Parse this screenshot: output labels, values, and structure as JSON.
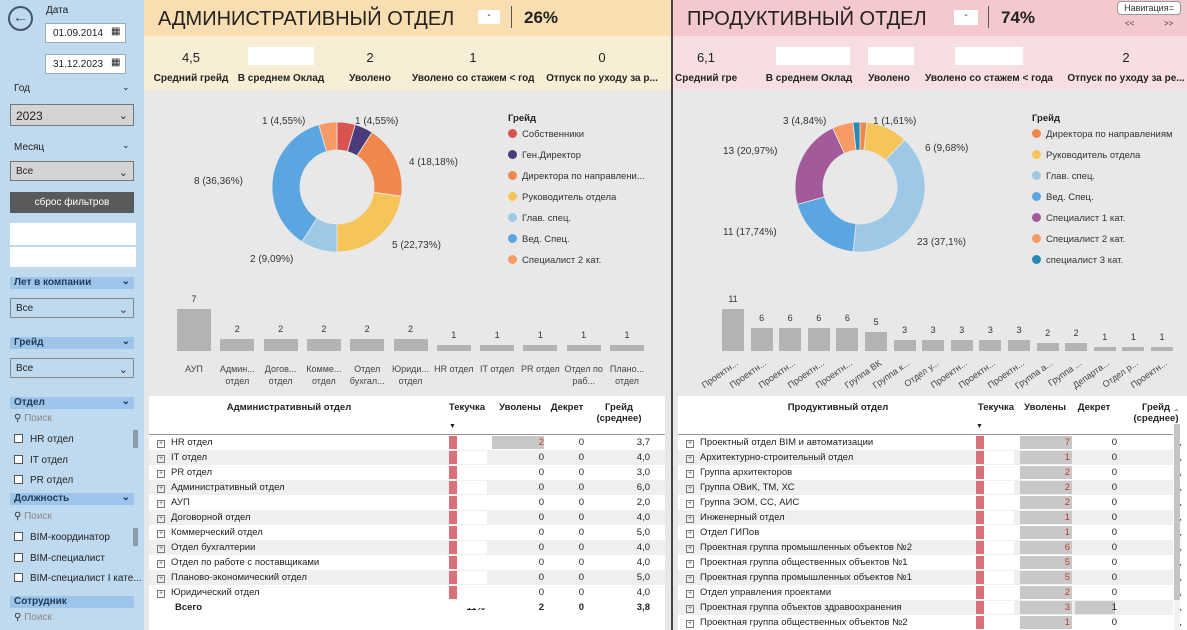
{
  "sidebar": {
    "date_label": "Дата",
    "date_from": "01.09.2014",
    "date_to": "31.12.2023",
    "year_label": "Год",
    "year_value": "2023",
    "month_label": "Месяц",
    "month_value": "Все",
    "reset_label": "сброс фильтров",
    "years_label": "Лет в компании",
    "years_value": "Все",
    "grade_label": "Грейд",
    "grade_value": "Все",
    "dept_label": "Отдел",
    "search_placeholder": "Поиск",
    "dept_items": [
      "HR отдел",
      "IT отдел",
      "PR отдел"
    ],
    "position_label": "Должность",
    "position_items": [
      "BIM-координатор",
      "BIM-специалист",
      "BIM-специалист I кате..."
    ],
    "employee_label": "Сотрудник"
  },
  "nav_label": "Навигация",
  "nav_prev": "<<",
  "nav_next": ">>",
  "admin": {
    "title": "АДМИНИСТРАТИВНЫЙ ОТДЕЛ",
    "dash": "-",
    "percent": "26%",
    "kpis": [
      {
        "value": "4,5",
        "label": "Средний грейд"
      },
      {
        "value": "",
        "label": "В среднем Оклад"
      },
      {
        "value": "2",
        "label": "Уволено"
      },
      {
        "value": "1",
        "label": "Уволено со стажем < года"
      },
      {
        "value": "0",
        "label": "Отпуск по уходу за р..."
      }
    ],
    "legend_title": "Грейд",
    "legend": [
      {
        "label": "Собственники",
        "color": "#d9534f"
      },
      {
        "label": "Ген.Директор",
        "color": "#4a3b7a"
      },
      {
        "label": "Директора по направлени...",
        "color": "#f0884d"
      },
      {
        "label": "Руководитель отдела",
        "color": "#f5c55a"
      },
      {
        "label": "Глав. спец.",
        "color": "#9ec9e6"
      },
      {
        "label": "Вед. Спец.",
        "color": "#5aa6e0"
      },
      {
        "label": "Специалист 2 кат.",
        "color": "#f79a66"
      }
    ],
    "donut": {
      "values": [
        1,
        1,
        4,
        5,
        2,
        8,
        1
      ],
      "labels": [
        "1 (4,55%)",
        "1 (4,55%)",
        "4 (18,18%)",
        "5 (22,73%)",
        "2 (9,09%)",
        "8 (36,36%)",
        "1 (4,55%)"
      ]
    },
    "bars": {
      "values": [
        7,
        2,
        2,
        2,
        2,
        2,
        1,
        1,
        1,
        1,
        1
      ],
      "categories": [
        "АУП",
        "Админ... отдел",
        "Догов... отдел",
        "Комме... отдел",
        "Отдел бухгал...",
        "Юриди... отдел",
        "HR отдел",
        "IT отдел",
        "PR отдел",
        "Отдел по раб...",
        "Плано... отдел"
      ]
    },
    "table": {
      "headers": [
        "Административный отдел",
        "Текучка",
        "Уволены",
        "Декрет",
        "Грейд (среднее)"
      ],
      "rows": [
        [
          "HR отдел",
          "2",
          "0",
          "3,7"
        ],
        [
          "IT отдел",
          "0",
          "0",
          "4,0"
        ],
        [
          "PR отдел",
          "0",
          "0",
          "3,0"
        ],
        [
          "Административный отдел",
          "0",
          "0",
          "6,0"
        ],
        [
          "АУП",
          "0",
          "0",
          "2,0"
        ],
        [
          "Договорной отдел",
          "0",
          "0",
          "4,0"
        ],
        [
          "Коммерческий отдел",
          "0",
          "0",
          "5,0"
        ],
        [
          "Отдел бухгалтерии",
          "0",
          "0",
          "4,0"
        ],
        [
          "Отдел по работе с поставщиками",
          "0",
          "0",
          "4,0"
        ],
        [
          "Планово-экономический отдел",
          "0",
          "0",
          "5,0"
        ],
        [
          "Юридический отдел",
          "0",
          "0",
          "4,0"
        ]
      ],
      "total": [
        "Всего",
        "11%",
        "2",
        "0",
        "3,8"
      ]
    }
  },
  "prod": {
    "title": "ПРОДУКТИВНЫЙ ОТДЕЛ",
    "dash": "-",
    "percent": "74%",
    "kpis": [
      {
        "value": "6,1",
        "label": "Средний грейд"
      },
      {
        "value": "",
        "label": "В среднем Оклад"
      },
      {
        "value": "",
        "label": "Уволено"
      },
      {
        "value": "",
        "label": "Уволено со стажем < года"
      },
      {
        "value": "2",
        "label": "Отпуск по уходу за ре..."
      }
    ],
    "legend_title": "Грейд",
    "legend": [
      {
        "label": "Директора по направлениям",
        "color": "#f0884d"
      },
      {
        "label": "Руководитель отдела",
        "color": "#f5c55a"
      },
      {
        "label": "Глав. спец.",
        "color": "#9ec9e6"
      },
      {
        "label": "Вед. Спец.",
        "color": "#5aa6e0"
      },
      {
        "label": "Специалист 1 кат.",
        "color": "#a25a9a"
      },
      {
        "label": "Специалист 2 кат.",
        "color": "#f79a66"
      },
      {
        "label": "специалист 3 кат.",
        "color": "#2a88b5"
      }
    ],
    "donut": {
      "values": [
        1,
        6,
        23,
        11,
        13,
        3,
        1
      ],
      "colors": [
        "#f0884d",
        "#f5c55a",
        "#9ec9e6",
        "#5aa6e0",
        "#a25a9a",
        "#f79a66",
        "#2a88b5"
      ],
      "labels": [
        "1 (1,61%)",
        "6 (9,68%)",
        "23 (37,1%)",
        "11 (17,74%)",
        "13 (20,97%)",
        "3 (4,84%)",
        ""
      ]
    },
    "bars": {
      "values": [
        11,
        6,
        6,
        6,
        6,
        5,
        3,
        3,
        3,
        3,
        3,
        2,
        2,
        1,
        1,
        1
      ],
      "categories": [
        "Проектн...",
        "Проектн...",
        "Проектн...",
        "Проектн...",
        "Проектн...",
        "Группа ВК",
        "Группа к...",
        "Отдел у...",
        "Проектн...",
        "Проектн...",
        "Проектн...",
        "Группа а...",
        "Группа ...",
        "Департа...",
        "Отдел р...",
        "Проектн..."
      ]
    },
    "table": {
      "headers": [
        "Продуктивный отдел",
        "Текучка",
        "Уволены",
        "Декрет",
        "Грейд (среднее)"
      ],
      "rows": [
        [
          "Проектный отдел BIM и автоматизации",
          "7",
          "0",
          "6,"
        ],
        [
          "Архитектурно-строительный отдел",
          "1",
          "0",
          "3,"
        ],
        [
          "Группа архитекторов",
          "2",
          "0",
          "5,"
        ],
        [
          "Группа ОВиК, ТМ, ХС",
          "2",
          "0",
          "4,"
        ],
        [
          "Группа ЭОМ, СС, АИС",
          "2",
          "0",
          "4,"
        ],
        [
          "Инженерный отдел",
          "1",
          "0",
          "5,"
        ],
        [
          "Отдел ГИПов",
          "1",
          "0",
          "4,"
        ],
        [
          "Проектная группа промышленных объектов №2",
          "6",
          "0",
          "6,"
        ],
        [
          "Проектная группа общественных объектов №1",
          "5",
          "0",
          "6,"
        ],
        [
          "Проектная группа промышленных объектов №1",
          "5",
          "0",
          "5,"
        ],
        [
          "Отдел управления проектами",
          "2",
          "0",
          "5,"
        ],
        [
          "Проектная группа объектов здравоохранения",
          "3",
          "1",
          "5,"
        ],
        [
          "Проектная группа общественных объектов №2",
          "1",
          "0",
          "6,"
        ]
      ]
    }
  }
}
